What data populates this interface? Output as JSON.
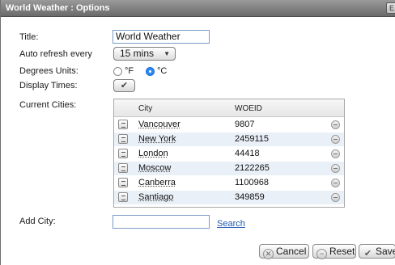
{
  "window": {
    "title": "World Weather : Options",
    "close_glyph": "E"
  },
  "form": {
    "title_label": "Title:",
    "title_value": "World Weather",
    "refresh_label": "Auto refresh every",
    "refresh_value": "15 mins",
    "units_label": "Degrees Units:",
    "unit_f": "°F",
    "unit_c": "°C",
    "unit_selected": "°C",
    "times_label": "Display Times:",
    "times_checked": true,
    "cities_label": "Current Cities:",
    "add_city_label": "Add City:",
    "add_city_value": "",
    "search_label": "Search"
  },
  "cities": {
    "headers": {
      "city": "City",
      "woeid": "WOEID"
    },
    "rows": [
      {
        "city": "Vancouver",
        "woeid": "9807"
      },
      {
        "city": "New York",
        "woeid": "2459115"
      },
      {
        "city": "London",
        "woeid": "44418"
      },
      {
        "city": "Moscow",
        "woeid": "2122265"
      },
      {
        "city": "Canberra",
        "woeid": "1100968"
      },
      {
        "city": "Santiago",
        "woeid": "349859"
      }
    ]
  },
  "buttons": {
    "cancel": "Cancel",
    "reset": "Reset",
    "save": "Save"
  },
  "icons": {
    "close": "close-icon",
    "dropdown": "chevron-down-icon",
    "check": "checkmark-icon",
    "row_handle": "list-icon",
    "row_remove": "minus-circle-icon",
    "cancel": "x-circle-icon",
    "reset": "reset-circle-icon",
    "save": "checkmark-icon"
  },
  "colors": {
    "titlebar": "#7a7a7a",
    "link": "#1f58b4",
    "radio_selected": "#2b88f0",
    "row_alt": "#eaf0f8"
  }
}
